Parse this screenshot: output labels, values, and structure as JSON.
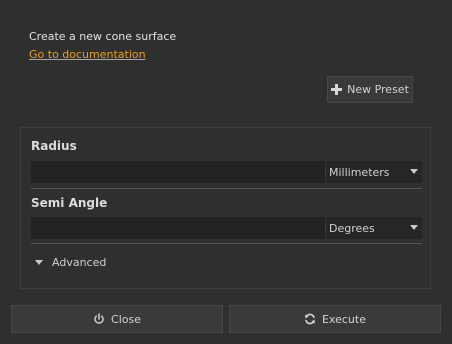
{
  "header": {
    "description": "Create a new cone surface",
    "doc_link": "Go to documentation"
  },
  "toolbar": {
    "new_preset_label": "New Preset",
    "new_preset_icon": "plus-icon"
  },
  "fields": {
    "radius": {
      "label": "Radius",
      "value": "",
      "unit": "Millimeters"
    },
    "semi_angle": {
      "label": "Semi Angle",
      "value": "",
      "unit": "Degrees"
    }
  },
  "advanced": {
    "label": "Advanced",
    "icon": "triangle-down-icon"
  },
  "actions": {
    "close_label": "Close",
    "close_icon": "power-icon",
    "execute_label": "Execute",
    "execute_icon": "refresh-icon"
  },
  "colors": {
    "background": "#2f2f2f",
    "link": "#e6a21e",
    "input_bg": "#222222"
  }
}
